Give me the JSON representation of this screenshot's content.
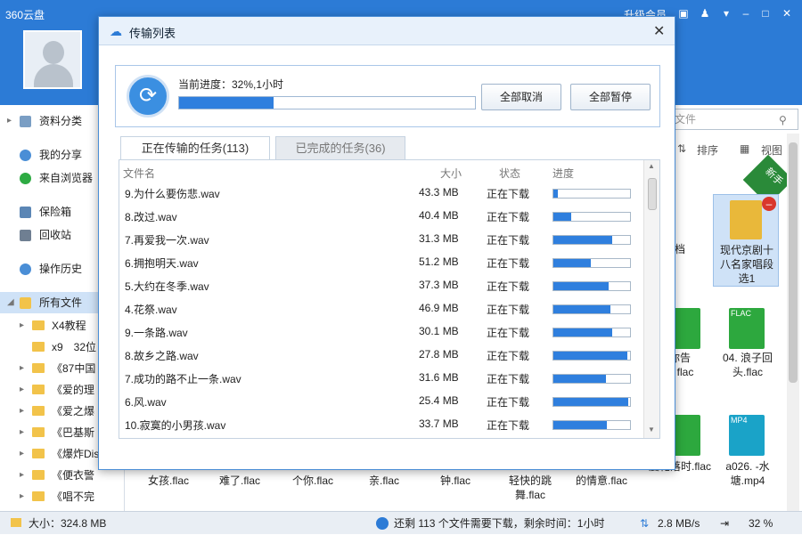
{
  "app": {
    "title": "360云盘",
    "upgrade": "升级会员"
  },
  "sidebar": {
    "items": [
      {
        "label": "资料分类"
      },
      {
        "label": "我的分享"
      },
      {
        "label": "来自浏览器"
      },
      {
        "label": "保险箱"
      },
      {
        "label": "回收站"
      },
      {
        "label": "操作历史"
      },
      {
        "label": "所有文件"
      }
    ],
    "tree": [
      "X4教程",
      "x9　32位",
      "《87中国",
      "《爱的理",
      "《爱之爆",
      "《巴基斯",
      "《爆炸Dis",
      "《便衣警",
      "《唱不完"
    ]
  },
  "main": {
    "search_placeholder": "文件",
    "sort_label": "排序",
    "view_label": "视图",
    "new_badge": "新手",
    "tiles": [
      {
        "label": "现代京剧十八名家唱段选1"
      },
      {
        "label": "档"
      },
      {
        "label": "你告"
      },
      {
        "label": "flac"
      },
      {
        "label": "04. 浪子回头.flac"
      },
      {
        "label": "a026. -水塘.mp4"
      },
      {
        "label": "度花落时.flac"
      }
    ],
    "bottom_labels": [
      "女孩.flac",
      "难了.flac",
      "个你.flac",
      "亲.flac",
      "钟.flac",
      "轻快的跳舞.flac",
      "的情意.flac"
    ],
    "flac_tag": "FLAC",
    "mp4_tag": "MP4"
  },
  "dialog": {
    "title": "传输列表",
    "progress_text": "当前进度：32%,1小时",
    "progress": 0.32,
    "cancel_all": "全部取消",
    "pause_all": "全部暂停",
    "tab_active": "正在传输的任务(113)",
    "tab_done": "已完成的任务(36)",
    "columns": {
      "name": "文件名",
      "size": "大小",
      "status": "状态",
      "progress": "进度"
    },
    "rows": [
      {
        "name": "9.为什么要伤悲.wav",
        "size": "43.3 MB",
        "status": "正在下载",
        "progress": 0.06
      },
      {
        "name": "8.改过.wav",
        "size": "40.4 MB",
        "status": "正在下载",
        "progress": 0.23
      },
      {
        "name": "7.再爱我一次.wav",
        "size": "31.3 MB",
        "status": "正在下载",
        "progress": 0.77
      },
      {
        "name": "6.拥抱明天.wav",
        "size": "51.2 MB",
        "status": "正在下载",
        "progress": 0.49
      },
      {
        "name": "5.大约在冬季.wav",
        "size": "37.3 MB",
        "status": "正在下载",
        "progress": 0.72
      },
      {
        "name": "4.花祭.wav",
        "size": "46.9 MB",
        "status": "正在下载",
        "progress": 0.74
      },
      {
        "name": "9.一条路.wav",
        "size": "30.1 MB",
        "status": "正在下载",
        "progress": 0.77
      },
      {
        "name": "8.故乡之路.wav",
        "size": "27.8 MB",
        "status": "正在下载",
        "progress": 0.97
      },
      {
        "name": "7.成功的路不止一条.wav",
        "size": "31.6 MB",
        "status": "正在下载",
        "progress": 0.69
      },
      {
        "name": "6.风.wav",
        "size": "25.4 MB",
        "status": "正在下载",
        "progress": 0.98
      },
      {
        "name": "10.寂寞的小男孩.wav",
        "size": "33.7 MB",
        "status": "正在下载",
        "progress": 0.7
      }
    ]
  },
  "statusbar": {
    "size": "大小：324.8 MB",
    "remaining": "还剩 113 个文件需要下载，剩余时间：1小时",
    "speed": "2.8 MB/s",
    "percent": "32 %"
  },
  "colors": {
    "accent": "#2c7bd6",
    "progress": "#2f7fde"
  }
}
